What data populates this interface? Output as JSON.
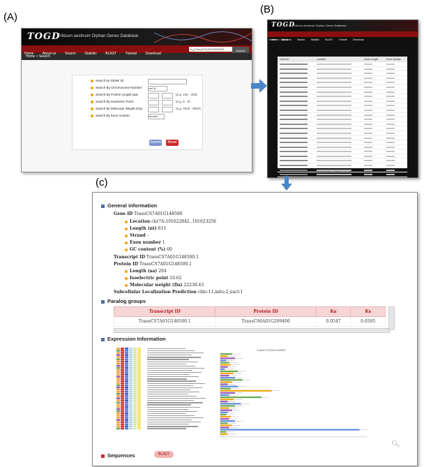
{
  "labels": {
    "a": "(A)",
    "b": "(B)",
    "c": "(c)"
  },
  "togd": {
    "logo": "TOGD",
    "subtitle": "Triticum aestivum Orphan Genes Database",
    "nav": [
      "Home",
      "About us",
      "Search",
      "Statistic",
      "BLAST",
      "Tutorial",
      "Download"
    ],
    "search_value": "e.g.TraesCS1A01G001000",
    "search_button": "Search",
    "breadcrumb": "Home > Search"
  },
  "search_form": {
    "rows": [
      {
        "label": "Search by GENE ID:",
        "hint": ""
      },
      {
        "label": "Search By Chromosome Number:",
        "hint": ""
      },
      {
        "label": "Search By Protein Length (aa):",
        "hint": "(e.g. 100 - 200)"
      },
      {
        "label": "Search By Isoelectric Point:",
        "hint": "(e.g. 6 - 8)"
      },
      {
        "label": "Search By Molecular Weight (Da):",
        "hint": "(e.g. 4000 - 8000)"
      },
      {
        "label": "Search By Exon number:",
        "hint": ""
      }
    ],
    "chrom_select": "chr7A",
    "exon_select": "choose",
    "submit": "Submit",
    "reset": "Reset"
  },
  "results": {
    "headers": [
      "Gene ID",
      "Location",
      "Gene Length",
      "Exon number"
    ],
    "pager": "« ‹ 1 2 3 4 5 › » Start 10 Results"
  },
  "gene": {
    "general_title": "General information",
    "gene_id_label": "Gene ID",
    "gene_id": "TraesCS7A01G148500",
    "location_label": "Location",
    "location": "chr7A:101622842..101623256",
    "length_label": "Length (nt)",
    "length": "615",
    "strand_label": "Strand",
    "strand": "-",
    "exon_label": "Exon number",
    "exon": "1",
    "gc_label": "GC content (%)",
    "gc": "60",
    "transcript_label": "Transcript ID",
    "transcript": "TraesCS7A01G148500.1",
    "protein_label": "Protein ID",
    "protein": "TraesCS7A01G148500.1",
    "plen_label": "Length (aa)",
    "plen": "204",
    "pi_label": "Isoelectric point",
    "pi": "10.62",
    "mw_label": "Molecular weight (Da)",
    "mw": "22238.43",
    "subcell_label": "Subcellular Localization Prediction",
    "subcell": "chlo:11,mito:2,nucl:1"
  },
  "paralog": {
    "title": "Paralog groups",
    "headers": [
      "Transcript ID",
      "Protein ID",
      "Ka",
      "Ks"
    ],
    "row": [
      "TraesCS7A01G148500.1",
      "TraesCS6A01G209400",
      "0.0547",
      "0.0595"
    ]
  },
  "expression": {
    "title": "Expression Information",
    "chart_series_label": "TraesCS7A01G148500",
    "bars_fraction": [
      0.08,
      0.05,
      0.1,
      0.04,
      0.06,
      0.07,
      0.05,
      0.03,
      0.12,
      0.09,
      0.06,
      0.1,
      0.15,
      0.08,
      0.05,
      0.12,
      0.07,
      0.35,
      0.1,
      0.06,
      0.28,
      0.09,
      0.05,
      0.14,
      0.1,
      0.06,
      0.08,
      0.05,
      0.04,
      0.07,
      0.06,
      0.1,
      0.05,
      0.08,
      0.06,
      0.95,
      0.04,
      0.05
    ],
    "heat_colors": [
      "#f4a742",
      "#d32f2f",
      "#4b7bd0",
      "#b7d4ea",
      "#d6e7a5",
      "#f5e35a"
    ]
  },
  "sequences": {
    "title": "Sequences",
    "blast": "BLAST"
  }
}
